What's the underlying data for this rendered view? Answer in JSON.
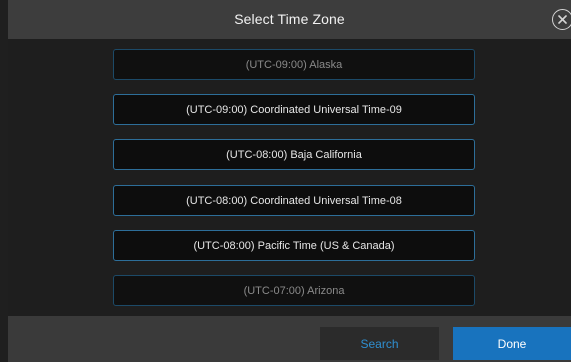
{
  "dialog": {
    "title": "Select Time Zone",
    "close_icon": "close-circle-icon"
  },
  "timezones": [
    {
      "label": "(UTC-09:00) Alaska",
      "state": "faded"
    },
    {
      "label": "(UTC-09:00) Coordinated Universal Time-09",
      "state": "normal"
    },
    {
      "label": "(UTC-08:00) Baja California",
      "state": "normal"
    },
    {
      "label": "(UTC-08:00) Coordinated Universal Time-08",
      "state": "normal"
    },
    {
      "label": "(UTC-08:00) Pacific Time (US & Canada)",
      "state": "normal"
    },
    {
      "label": "(UTC-07:00) Arizona",
      "state": "faded"
    }
  ],
  "buttons": {
    "search_label": "Search",
    "done_label": "Done"
  },
  "colors": {
    "accent": "#1873be",
    "search_text": "#2f8fd0",
    "item_border": "#2d6e99"
  }
}
